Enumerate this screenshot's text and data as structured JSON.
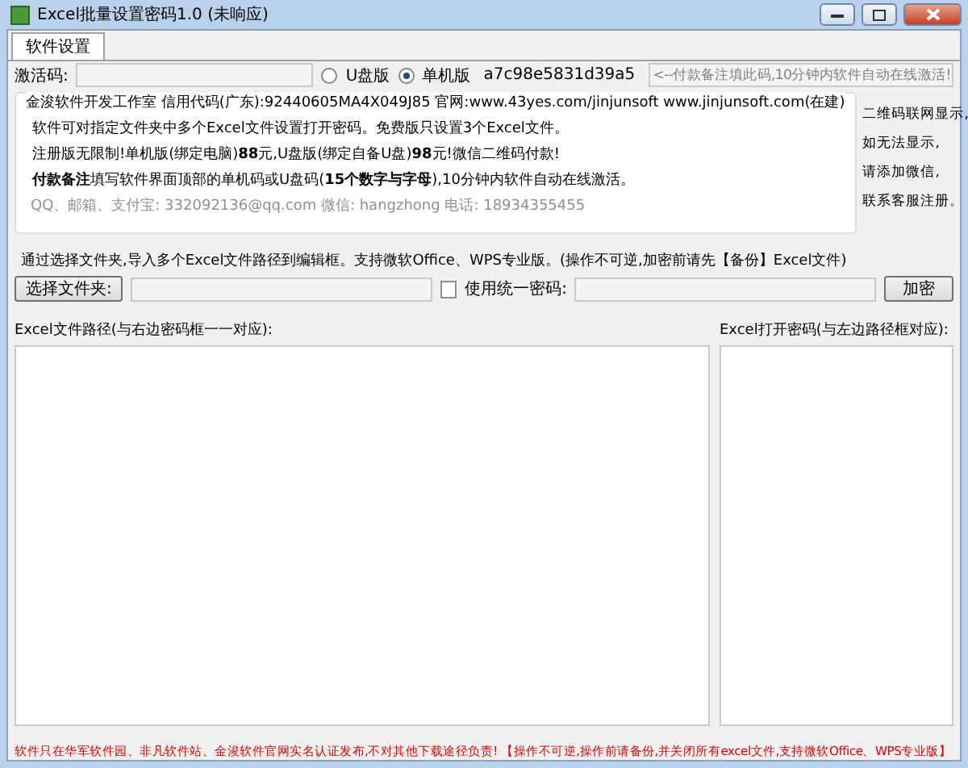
{
  "window": {
    "title": "Excel批量设置密码1.0 (未响应)"
  },
  "tabs": [
    {
      "label": "软件设置",
      "selected": true
    }
  ],
  "activation": {
    "label": "激活码:",
    "editions": [
      {
        "label": "U盘版",
        "selected": false
      },
      {
        "label": "单机版",
        "selected": true
      }
    ],
    "machine_code": "a7c98e5831d39a5",
    "hint": "<--付款备注填此码,10分钟内软件自动在线激活!"
  },
  "info": {
    "title": "金浚软件开发工作室 信用代码(广东):92440605MA4X049J85 官网:www.43yes.com/jinjunsoft  www.jinjunsoft.com(在建)",
    "lines": [
      {
        "kind": "plain",
        "text": "软件可对指定文件夹中多个Excel文件设置打开密码。免费版只设置3个Excel文件。"
      },
      {
        "kind": "price",
        "text": "注册版无限制!单机版(绑定电脑)**88**元,U盘版(绑定自备U盘)**98**元!微信二维码付款!"
      },
      {
        "kind": "plain",
        "text": "**付款备注**填写软件界面顶部的单机码或U盘码(**15个数字与字母**),10分钟内软件自动在线激活。"
      },
      {
        "kind": "contact",
        "text": "QQ、邮箱、支付宝: 332092136@qq.com   微信: hangzhong   电话: 18934355455"
      }
    ]
  },
  "qr_notes": [
    "二维码联网显示,",
    "如无法显示,",
    "请添加微信,",
    "联系客服注册。"
  ],
  "batch": {
    "title": "通过选择文件夹,导入多个Excel文件路径到编辑框。支持微软Office、WPS专业版。(操作不可逆,加密前请先【备份】Excel文件)",
    "folder_button": "选择文件夹:",
    "use_same_password": {
      "label": "使用统一密码:",
      "checked": false
    },
    "encrypt_button": "加密",
    "path_label": "Excel文件路径(与右边密码框一一对应):",
    "password_label": "Excel打开密码(与左边路径框对应):"
  },
  "footer": "软件只在华军软件园、非凡软件站、金浚软件官网实名认证发布,不对其他下载途径负责! 【操作不可逆,操作前请备份,并关闭所有excel文件,支持微软Office、WPS专业版】"
}
